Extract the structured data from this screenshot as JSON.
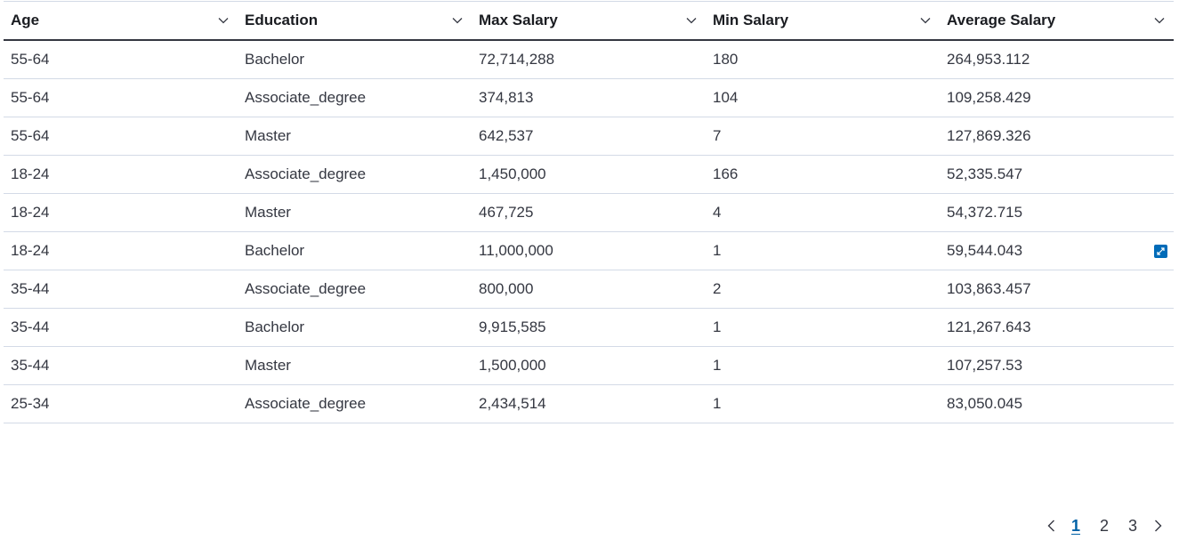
{
  "table": {
    "columns": [
      {
        "label": "Age"
      },
      {
        "label": "Education"
      },
      {
        "label": "Max Salary"
      },
      {
        "label": "Min Salary"
      },
      {
        "label": "Average Salary"
      }
    ],
    "rows": [
      [
        "55-64",
        "Bachelor",
        "72,714,288",
        "180",
        "264,953.112"
      ],
      [
        "55-64",
        "Associate_degree",
        "374,813",
        "104",
        "109,258.429"
      ],
      [
        "55-64",
        "Master",
        "642,537",
        "7",
        "127,869.326"
      ],
      [
        "18-24",
        "Associate_degree",
        "1,450,000",
        "166",
        "52,335.547"
      ],
      [
        "18-24",
        "Master",
        "467,725",
        "4",
        "54,372.715"
      ],
      [
        "18-24",
        "Bachelor",
        "11,000,000",
        "1",
        "59,544.043"
      ],
      [
        "35-44",
        "Associate_degree",
        "800,000",
        "2",
        "103,863.457"
      ],
      [
        "35-44",
        "Bachelor",
        "9,915,585",
        "1",
        "121,267.643"
      ],
      [
        "35-44",
        "Master",
        "1,500,000",
        "1",
        "107,257.53"
      ],
      [
        "25-34",
        "Associate_degree",
        "2,434,514",
        "1",
        "83,050.045"
      ]
    ],
    "expand_icon": "expand-icon",
    "sort_icon": "chevron-down-icon"
  },
  "pagination": {
    "pages": [
      "1",
      "2",
      "3"
    ],
    "current_page": "1",
    "prev_icon": "chevron-left-icon",
    "next_icon": "chevron-right-icon"
  },
  "colors": {
    "header_rule": "#343741",
    "row_border": "#d3dae6",
    "accent": "#006bb8",
    "active_page": "#0061a6"
  }
}
